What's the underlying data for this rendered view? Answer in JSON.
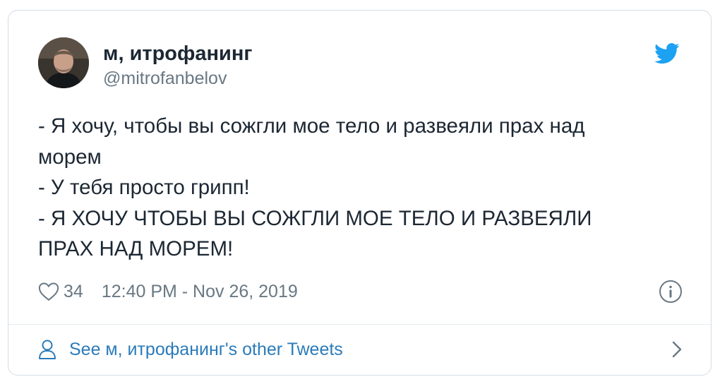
{
  "author": {
    "display_name": "м, итрофанинг",
    "handle": "@mitrofanbelov",
    "avatar_icon": "user-avatar-photo"
  },
  "tweet": {
    "text": "- Я хочу, чтобы вы сожгли мое тело и развеяли прах над\nморем\n- У тебя просто грипп!\n- Я ХОЧУ ЧТОБЫ ВЫ СОЖГЛИ МОЕ ТЕЛО И РАЗВЕЯЛИ\nПРАХ НАД МОРЕМ!",
    "likes": "34",
    "timestamp": "12:40 PM - Nov 26, 2019"
  },
  "footer": {
    "link_label": "See м, итрофанинг's other Tweets"
  },
  "icons": {
    "brand": "twitter-bird-icon",
    "like": "heart-icon",
    "info": "info-icon",
    "profile": "person-icon",
    "navigate": "chevron-right-icon"
  },
  "colors": {
    "brand_blue": "#1da1f2",
    "link_blue": "#2b7bb9",
    "text_primary": "#1c2733",
    "text_secondary": "#697883",
    "border": "#d3dde5"
  }
}
